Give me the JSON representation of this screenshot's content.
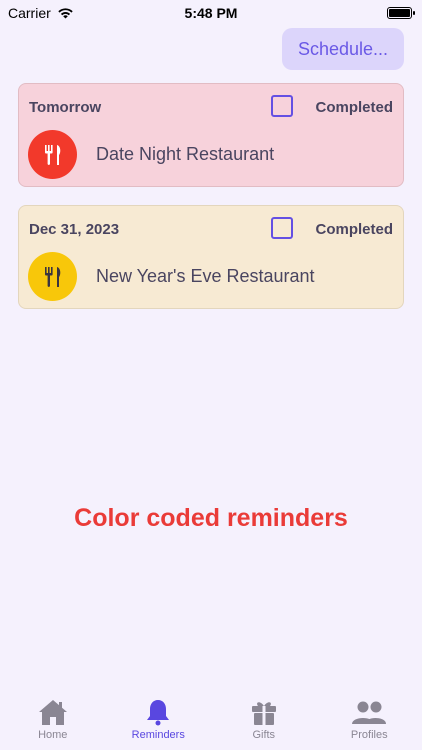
{
  "status_bar": {
    "carrier": "Carrier",
    "time": "5:48 PM"
  },
  "header": {
    "schedule_label": "Schedule..."
  },
  "reminders": [
    {
      "date": "Tomorrow",
      "completed_label": "Completed",
      "title": "Date Night Restaurant",
      "icon": "fork-knife-icon",
      "color": "#f2392b",
      "card_color": "#f7d2db"
    },
    {
      "date": "Dec 31, 2023",
      "completed_label": "Completed",
      "title": "New Year's Eve Restaurant",
      "icon": "fork-knife-icon",
      "color": "#f8c70a",
      "card_color": "#f7ead3"
    }
  ],
  "promo_text": "Color coded reminders",
  "tabs": [
    {
      "label": "Home",
      "icon": "house-icon"
    },
    {
      "label": "Reminders",
      "icon": "bell-icon",
      "active": true
    },
    {
      "label": "Gifts",
      "icon": "gift-icon"
    },
    {
      "label": "Profiles",
      "icon": "people-icon"
    }
  ],
  "colors": {
    "accent": "#5947e0",
    "promo": "#ea3b38",
    "background": "#f5f1fd"
  }
}
